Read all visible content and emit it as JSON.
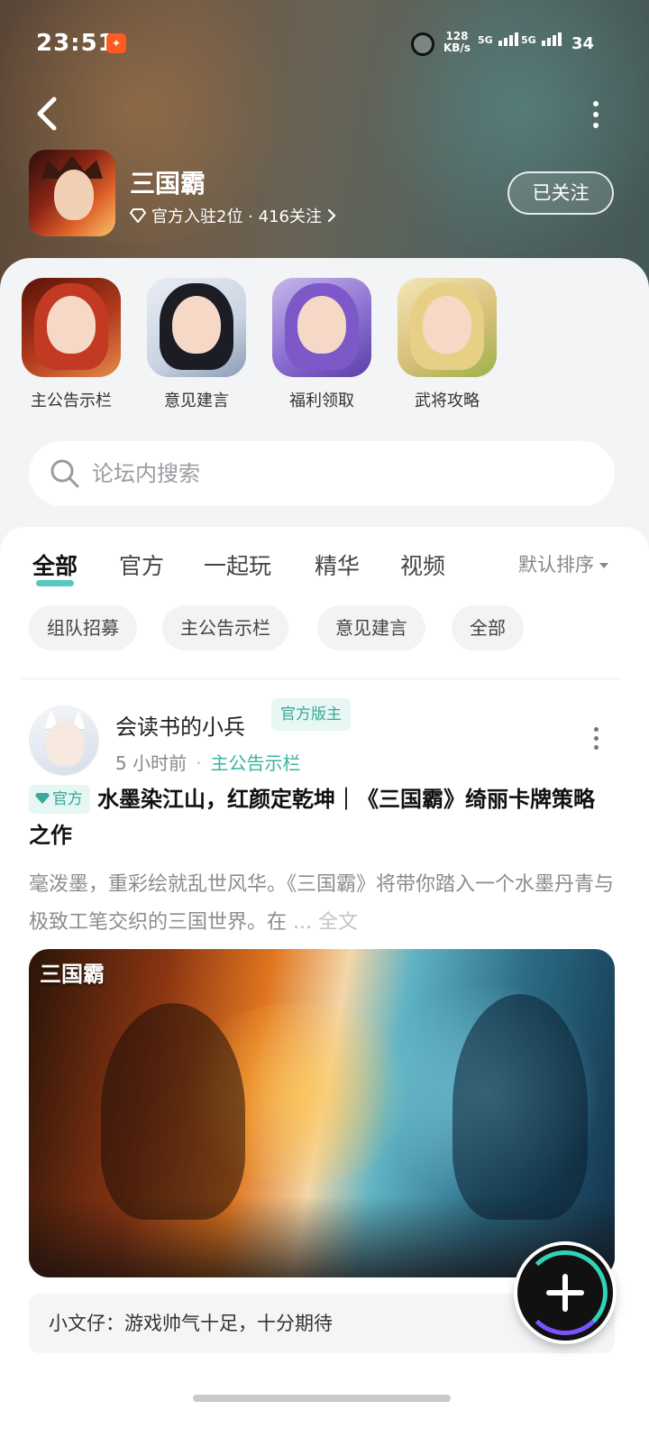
{
  "status_bar": {
    "time": "23:51",
    "net_speed_value": "128",
    "net_speed_unit": "KB/s",
    "sim1": "5G",
    "sim2": "5G",
    "battery": "34"
  },
  "header": {
    "game_name": "三国霸",
    "sub_text": "官方入驻2位 · 416关注",
    "follow_label": "已关注"
  },
  "quick_links": [
    {
      "label": "主公告示栏"
    },
    {
      "label": "意见建言"
    },
    {
      "label": "福利领取"
    },
    {
      "label": "武将攻略"
    }
  ],
  "search": {
    "placeholder": "论坛内搜索"
  },
  "tabs": [
    {
      "label": "全部"
    },
    {
      "label": "官方"
    },
    {
      "label": "一起玩"
    },
    {
      "label": "精华"
    },
    {
      "label": "视频"
    }
  ],
  "sort_label": "默认排序",
  "chips": [
    {
      "label": "组队招募"
    },
    {
      "label": "主公告示栏"
    },
    {
      "label": "意见建言"
    },
    {
      "label": "全部"
    }
  ],
  "post": {
    "author": "会读书的小兵",
    "author_badge": "官方版主",
    "time": "5 小时前",
    "separator": "·",
    "board": "主公告示栏",
    "official_tag": "官方",
    "title": "水墨染江山，红颜定乾坤｜《三国霸》绮丽卡牌策略之作",
    "excerpt": "毫泼墨，重彩绘就乱世风华。《三国霸》将带你踏入一个水墨丹青与极致工笔交织的三国世界。在",
    "ellipsis": "...",
    "full_text_label": "全文",
    "banner_logo": "三国霸",
    "comment_author": "小文仔：",
    "comment_text": "游戏帅气十足，十分期待"
  },
  "colors": {
    "accent": "#36c0b0",
    "fab": "#111111"
  },
  "icons": {
    "back": "chevron-left-icon",
    "more": "more-vertical-icon",
    "search": "search-icon",
    "diamond": "diamond-icon",
    "add": "plus-icon"
  }
}
